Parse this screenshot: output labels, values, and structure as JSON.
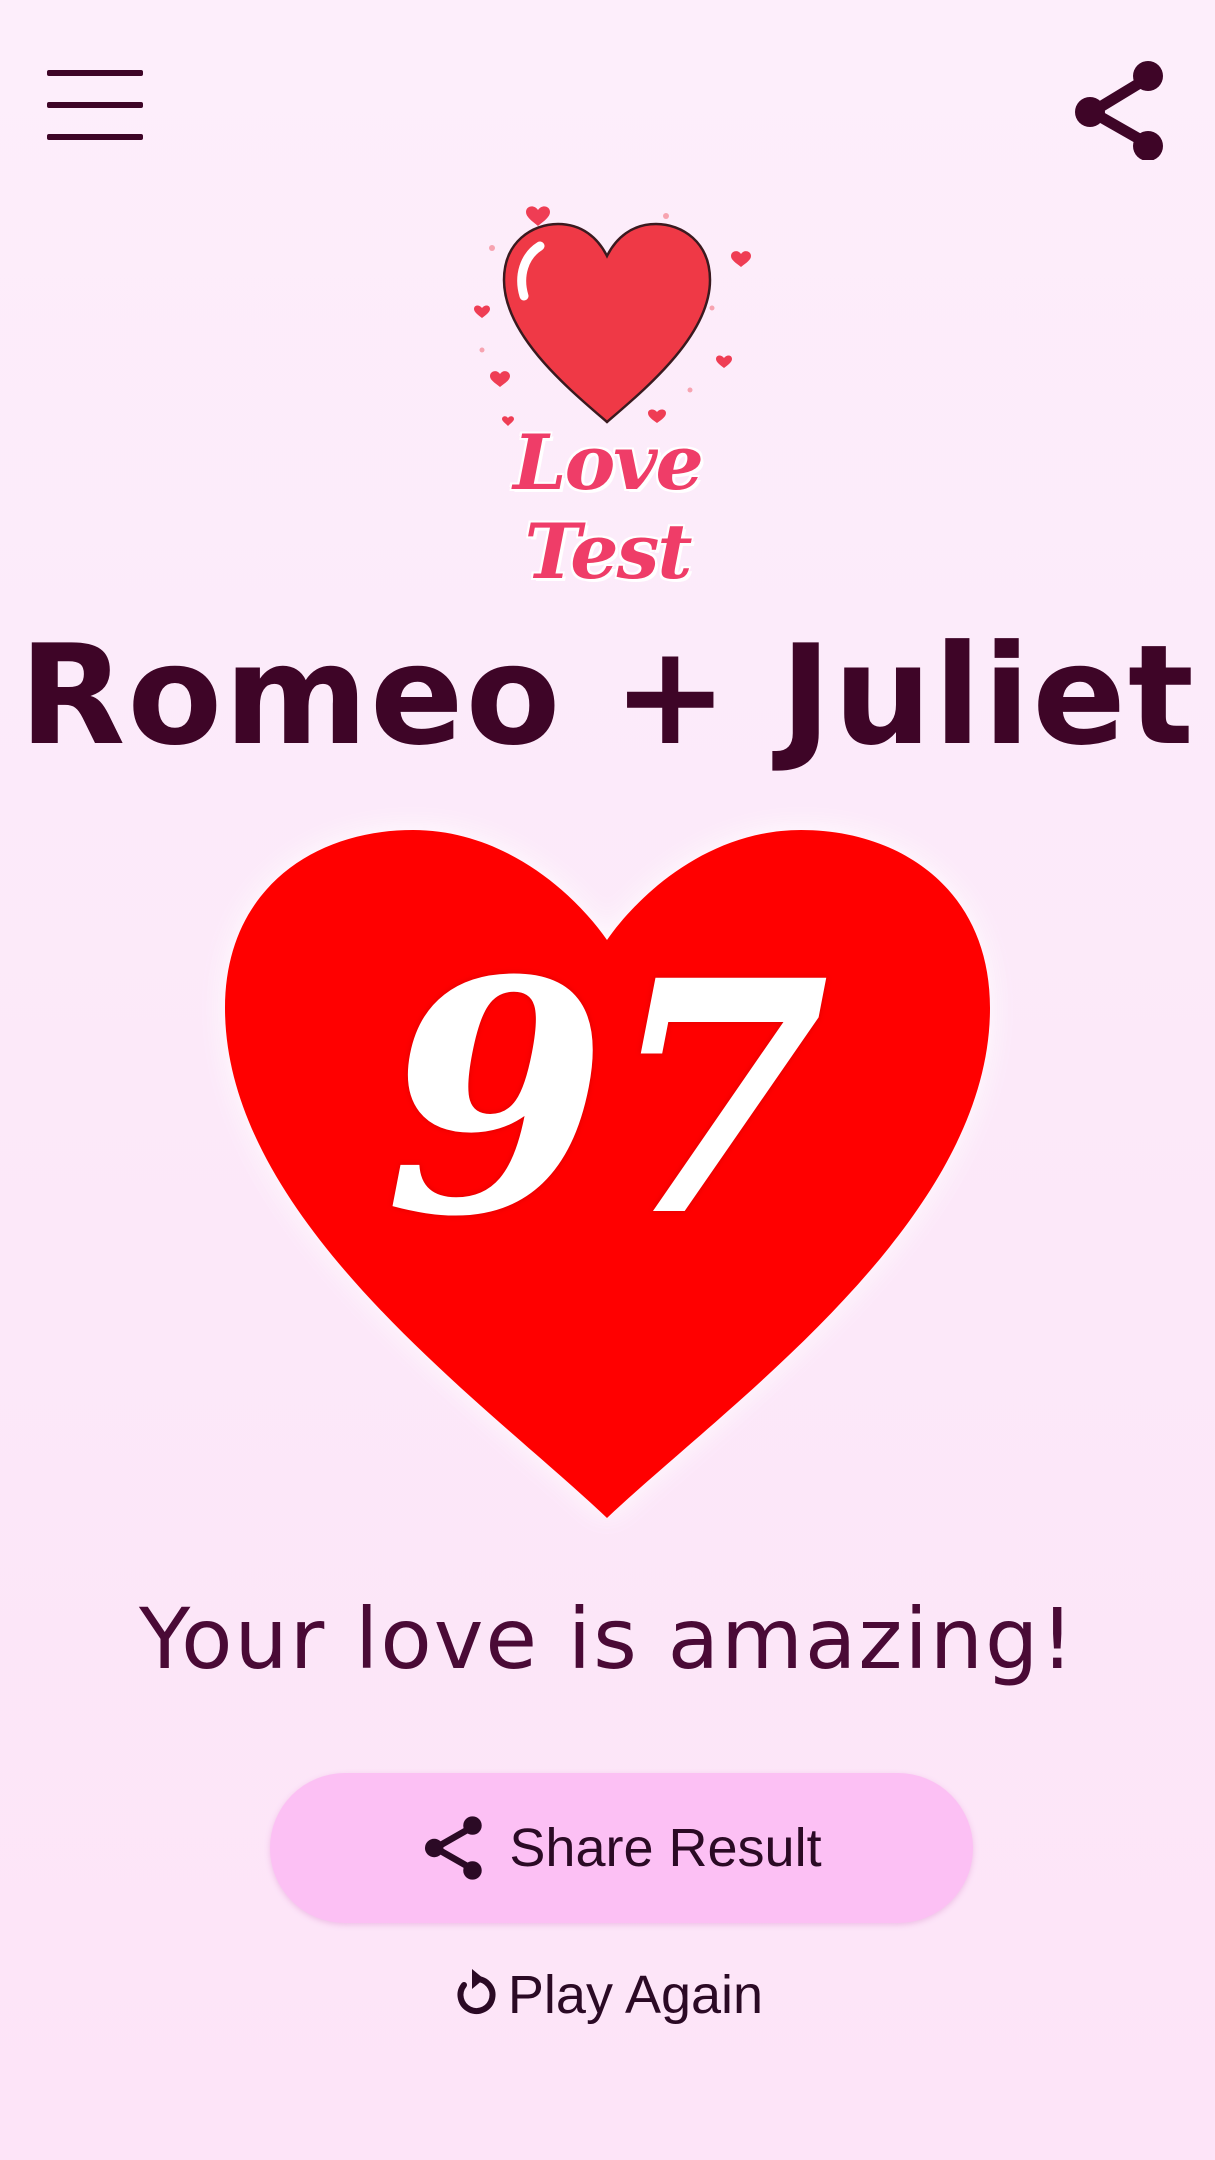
{
  "header": {
    "menu_icon": "hamburger-menu-icon",
    "share_icon": "share-icon"
  },
  "logo": {
    "text": "Love Test",
    "icon": "heart-icon"
  },
  "result": {
    "names": "Romeo + Juliet",
    "score": "97",
    "message": "Your love is amazing!"
  },
  "actions": {
    "share_label": "Share Result",
    "share_icon": "share-icon",
    "play_again_label": "Play Again",
    "play_again_icon": "refresh-icon"
  },
  "colors": {
    "heart": "#ff0000",
    "logo_text": "#ef3d68",
    "primary_text": "#3e0527",
    "button_bg": "#fcc0f4"
  }
}
